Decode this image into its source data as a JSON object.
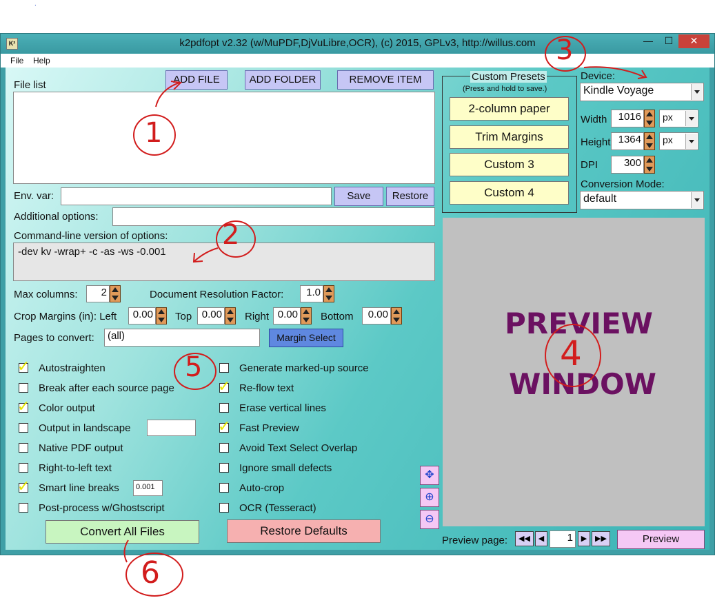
{
  "window": {
    "title": "k2pdfopt v2.32 (w/MuPDF,DjVuLibre,OCR), (c) 2015, GPLv3, http://willus.com",
    "icon": "K²",
    "controls": {
      "minimize": "—",
      "maximize": "☐",
      "close": "✕"
    }
  },
  "menu": {
    "file": "File",
    "help": "Help"
  },
  "file_list": {
    "label": "File list",
    "add_file": "ADD FILE",
    "add_folder": "ADD FOLDER",
    "remove_item": "REMOVE ITEM"
  },
  "env": {
    "label": "Env. var:",
    "value": "",
    "save": "Save",
    "restore": "Restore"
  },
  "additional": {
    "label": "Additional options:",
    "value": ""
  },
  "cmdline": {
    "label": "Command-line version of options:",
    "value": "-dev kv -wrap+ -c -as -ws -0.001"
  },
  "numbers": {
    "max_columns_label": "Max columns:",
    "max_columns": "2",
    "doc_res_label": "Document Resolution Factor:",
    "doc_res": "1.0",
    "crop_label": "Crop Margins (in): Left",
    "crop_left": "0.00",
    "top_label": "Top",
    "crop_top": "0.00",
    "right_label": "Right",
    "crop_right": "0.00",
    "bottom_label": "Bottom",
    "crop_bottom": "0.00",
    "pages_label": "Pages to convert:",
    "pages": "(all)",
    "margin_select": "Margin Select"
  },
  "checkboxes_left": [
    {
      "label": "Autostraighten",
      "checked": true
    },
    {
      "label": "Break after each source page",
      "checked": false
    },
    {
      "label": "Color output",
      "checked": true
    },
    {
      "label": "Output in landscape",
      "checked": false
    },
    {
      "label": "Native PDF output",
      "checked": false
    },
    {
      "label": "Right-to-left text",
      "checked": false
    },
    {
      "label": "Smart line breaks",
      "checked": true
    },
    {
      "label": "Post-process w/Ghostscript",
      "checked": false
    }
  ],
  "checkboxes_right": [
    {
      "label": "Generate marked-up source",
      "checked": false
    },
    {
      "label": "Re-flow text",
      "checked": true
    },
    {
      "label": "Erase vertical lines",
      "checked": false
    },
    {
      "label": "Fast Preview",
      "checked": true
    },
    {
      "label": "Avoid Text Select Overlap",
      "checked": false
    },
    {
      "label": "Ignore small defects",
      "checked": false
    },
    {
      "label": "Auto-crop",
      "checked": false
    },
    {
      "label": "OCR (Tesseract)",
      "checked": false
    }
  ],
  "smart_line_breaks_value": "0.001",
  "landscape_value": "",
  "actions": {
    "convert": "Convert All Files",
    "restore_defaults": "Restore Defaults"
  },
  "presets": {
    "title": "Custom Presets",
    "subtitle": "(Press and hold to save.)",
    "items": [
      "2-column paper",
      "Trim Margins",
      "Custom 3",
      "Custom 4"
    ]
  },
  "device": {
    "label": "Device:",
    "value": "Kindle Voyage",
    "width_label": "Width",
    "width": "1016",
    "width_unit": "px",
    "height_label": "Height",
    "height": "1364",
    "height_unit": "px",
    "dpi_label": "DPI",
    "dpi": "300",
    "mode_label": "Conversion Mode:",
    "mode": "default"
  },
  "preview": {
    "line1": "PREVIEW",
    "line2": "WINDOW",
    "page_label": "Preview page:",
    "page": "1",
    "button": "Preview",
    "nav": {
      "first": "◀◀",
      "prev": "◀",
      "next": "▶",
      "last": "▶▶"
    }
  },
  "annotations": [
    "1",
    "2",
    "3",
    "4",
    "5",
    "6"
  ],
  "colors": {
    "accent_red": "#d21d1d",
    "preview_text": "#6b1161",
    "teal": "#3bb3b5"
  }
}
